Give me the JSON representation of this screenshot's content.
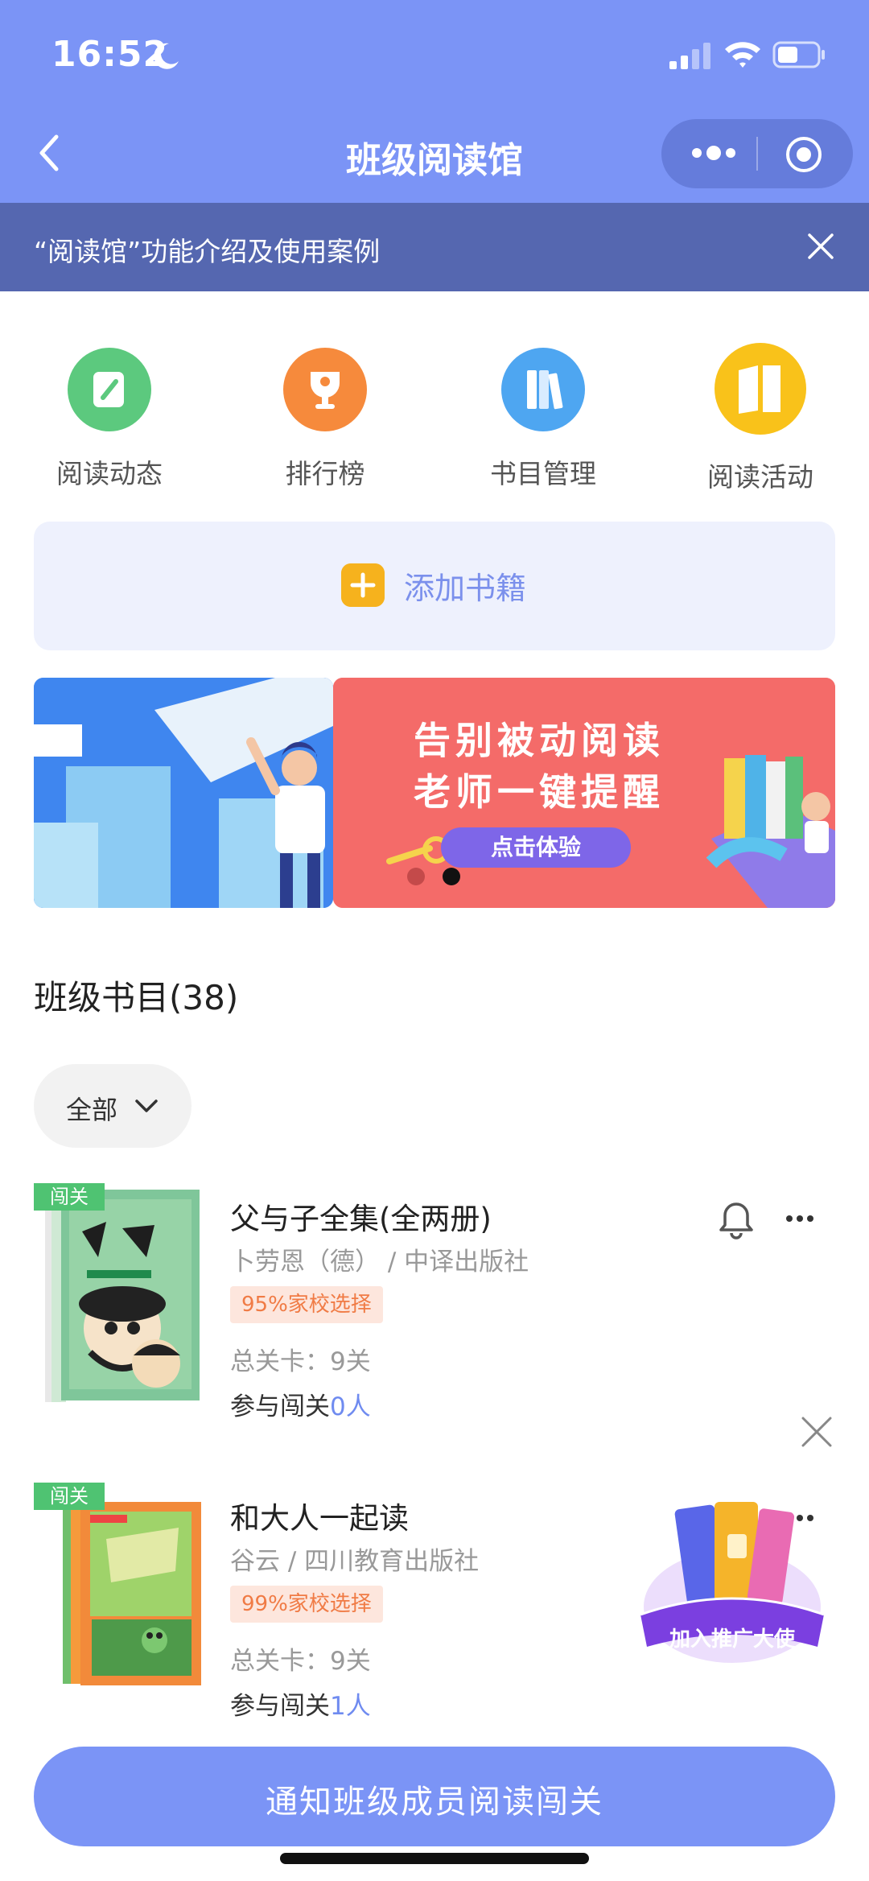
{
  "status": {
    "time": "16:52"
  },
  "nav": {
    "title": "班级阅读馆"
  },
  "notice": {
    "text": "“阅读馆”功能介绍及使用案例"
  },
  "entries": [
    {
      "label": "阅读动态",
      "icon": "pen-note-icon",
      "color": "#5cc97e"
    },
    {
      "label": "排行榜",
      "icon": "trophy-icon",
      "color": "#f68a3c"
    },
    {
      "label": "书目管理",
      "icon": "books-icon",
      "color": "#4ea6f1"
    },
    {
      "label": "阅读活动",
      "icon": "open-book-icon",
      "color": "#f9c21a"
    }
  ],
  "add_book": {
    "label": "添加书籍"
  },
  "banner": {
    "line1": "告别被动阅读",
    "line2": "老师一键提醒",
    "button": "点击体验",
    "active_slide": 2,
    "slide_count": 2
  },
  "section": {
    "title": "班级书目(38)"
  },
  "filter": {
    "label": "全部"
  },
  "books": [
    {
      "tag": "闯关",
      "title": "父与子全集(全两册)",
      "author": "卜劳恩（德） / 中译出版社",
      "badge": "95%家校选择",
      "levels": "总关卡：9关",
      "join_prefix": "参与闯关",
      "join_count": "0人"
    },
    {
      "tag": "闯关",
      "title": "和大人一起读",
      "author": "谷云 / 四川教育出版社",
      "badge": "99%家校选择",
      "levels": "总关卡：9关",
      "join_prefix": "参与闯关",
      "join_count": "1人"
    }
  ],
  "promo": {
    "label": "加入推广大使"
  },
  "cta": {
    "label": "通知班级成员阅读闯关"
  },
  "colors": {
    "header": "#7b94f6",
    "notice": "#5567b0",
    "accent": "#6f8bf0",
    "badge_text": "#f07b45",
    "tag": "#4fc372"
  }
}
